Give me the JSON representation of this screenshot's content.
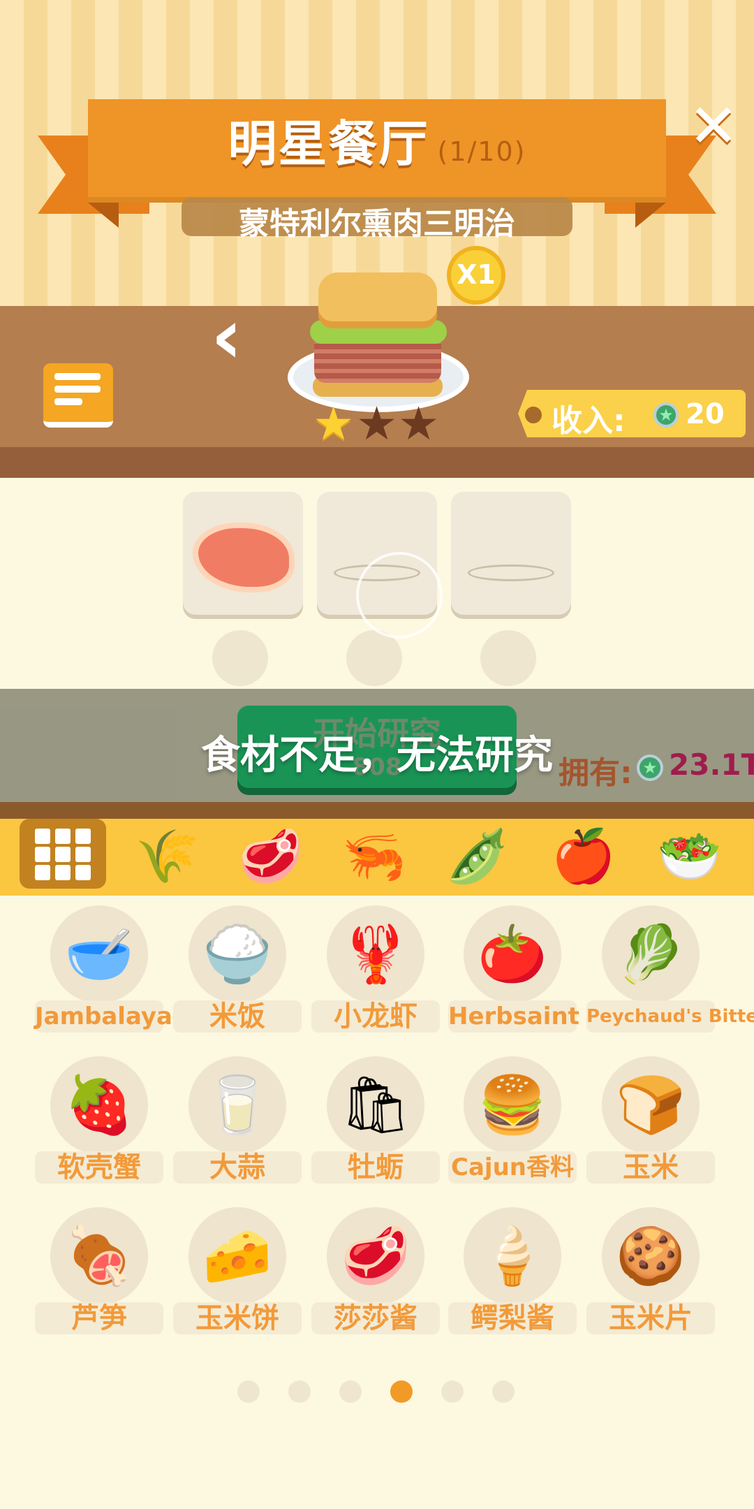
{
  "header": {
    "title": "明星餐厅",
    "title_count": "(1/10)",
    "subtitle": "蒙特利尔熏肉三明治",
    "close_icon": "close-icon"
  },
  "dish": {
    "multiplier": "X1",
    "stars_filled": 1,
    "stars_total": 3
  },
  "income": {
    "label": "收入:",
    "value": "20",
    "currency_icon": "star-gem-icon"
  },
  "research": {
    "slots": [
      "steak",
      "empty",
      "empty"
    ],
    "start_label": "开始研究",
    "start_cost": "808",
    "toast": "食材不足，无法研究",
    "owned_label": "拥有:",
    "owned_value": "23.1T"
  },
  "categories": [
    "all-grid-icon",
    "grain-icon",
    "meat-icon",
    "shrimp-icon",
    "pea-pod-icon",
    "apple-icon",
    "salad-bowl-icon"
  ],
  "ingredients": [
    {
      "label": "Jambalaya香料",
      "icon": "🥣"
    },
    {
      "label": "米饭",
      "icon": "🍚"
    },
    {
      "label": "小龙虾",
      "icon": "🦞"
    },
    {
      "label": "Herbsaint",
      "icon": "🍅"
    },
    {
      "label": "Peychaud's Bitters",
      "icon": "🥬"
    },
    {
      "label": "软壳蟹",
      "icon": "🍓"
    },
    {
      "label": "大蒜",
      "icon": "🥛"
    },
    {
      "label": "牡蛎",
      "icon": "🛍"
    },
    {
      "label": "Cajun香料",
      "icon": "🍔"
    },
    {
      "label": "玉米",
      "icon": "🍞"
    },
    {
      "label": "芦笋",
      "icon": "🍖"
    },
    {
      "label": "玉米饼",
      "icon": "🧀"
    },
    {
      "label": "莎莎酱",
      "icon": "🥩"
    },
    {
      "label": "鳄梨酱",
      "icon": "🍦"
    },
    {
      "label": "玉米片",
      "icon": "🍪"
    }
  ],
  "pagination": {
    "pages": 6,
    "current": 4
  }
}
